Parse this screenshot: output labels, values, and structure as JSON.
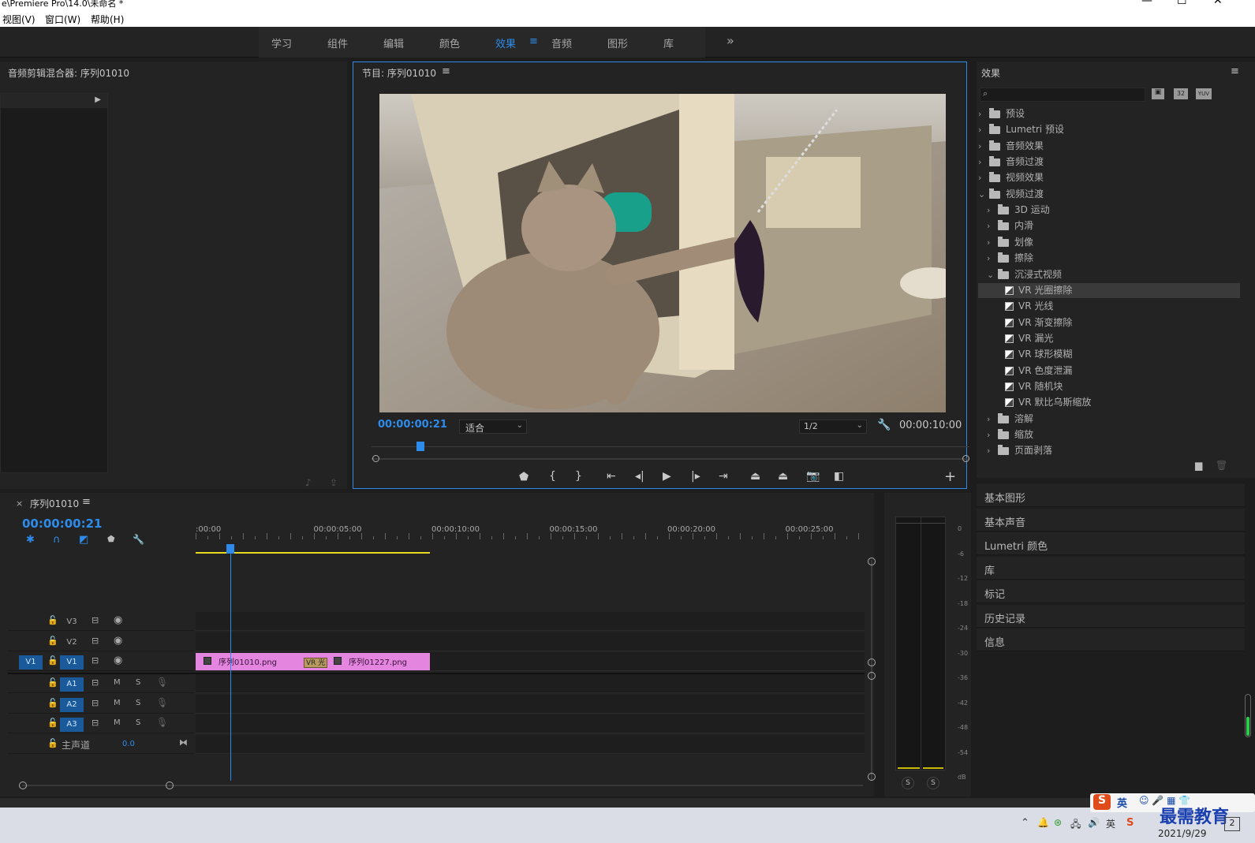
{
  "window": {
    "title": "e\\Premiere Pro\\14.0\\未命名 *",
    "minimize": "—",
    "maximize": "☐",
    "close": "✕"
  },
  "menu": {
    "items": [
      "视图(V)",
      "窗口(W)",
      "帮助(H)"
    ]
  },
  "workspaces": {
    "items": [
      "学习",
      "组件",
      "编辑",
      "颜色",
      "效果",
      "音频",
      "图形",
      "库"
    ],
    "active": "效果",
    "more": "»"
  },
  "audio_mixer": {
    "title": "音频剪辑混合器: 序列01010"
  },
  "program": {
    "title": "节目: 序列01010",
    "timecode": "00:00:00:21",
    "fit": "适合",
    "resolution": "1/2",
    "duration": "00:00:10:00",
    "add": "+"
  },
  "effects": {
    "title": "效果",
    "search_placeholder": "",
    "badges": [
      "32",
      "YUV"
    ],
    "tree": [
      {
        "label": "预设",
        "level": 0,
        "open": false,
        "kind": "star-folder"
      },
      {
        "label": "Lumetri 预设",
        "level": 0,
        "open": false,
        "kind": "star-folder"
      },
      {
        "label": "音频效果",
        "level": 0,
        "open": false,
        "kind": "folder"
      },
      {
        "label": "音频过渡",
        "level": 0,
        "open": false,
        "kind": "folder"
      },
      {
        "label": "视频效果",
        "level": 0,
        "open": false,
        "kind": "folder"
      },
      {
        "label": "视频过渡",
        "level": 0,
        "open": true,
        "kind": "folder"
      },
      {
        "label": "3D 运动",
        "level": 1,
        "open": false,
        "kind": "folder"
      },
      {
        "label": "内滑",
        "level": 1,
        "open": false,
        "kind": "folder"
      },
      {
        "label": "划像",
        "level": 1,
        "open": false,
        "kind": "folder"
      },
      {
        "label": "擦除",
        "level": 1,
        "open": false,
        "kind": "folder"
      },
      {
        "label": "沉浸式视频",
        "level": 1,
        "open": true,
        "kind": "folder"
      },
      {
        "label": "VR 光圈擦除",
        "level": 2,
        "kind": "fx",
        "selected": true
      },
      {
        "label": "VR 光线",
        "level": 2,
        "kind": "fx"
      },
      {
        "label": "VR 渐变擦除",
        "level": 2,
        "kind": "fx"
      },
      {
        "label": "VR 漏光",
        "level": 2,
        "kind": "fx"
      },
      {
        "label": "VR 球形模糊",
        "level": 2,
        "kind": "fx"
      },
      {
        "label": "VR 色度泄漏",
        "level": 2,
        "kind": "fx"
      },
      {
        "label": "VR 随机块",
        "level": 2,
        "kind": "fx"
      },
      {
        "label": "VR 默比乌斯缩放",
        "level": 2,
        "kind": "fx"
      },
      {
        "label": "溶解",
        "level": 1,
        "open": false,
        "kind": "folder"
      },
      {
        "label": "缩放",
        "level": 1,
        "open": false,
        "kind": "folder"
      },
      {
        "label": "页面剥落",
        "level": 1,
        "open": false,
        "kind": "folder"
      }
    ]
  },
  "side_panels": [
    "基本图形",
    "基本声音",
    "Lumetri 颜色",
    "库",
    "标记",
    "历史记录",
    "信息"
  ],
  "timeline": {
    "tab": "序列01010",
    "timecode": "00:00:00:21",
    "ruler": [
      ":00:00",
      "00:00:05:00",
      "00:00:10:00",
      "00:00:15:00",
      "00:00:20:00",
      "00:00:25:00"
    ],
    "video_tracks": [
      "V3",
      "V2",
      "V1"
    ],
    "source_v": "V1",
    "audio_tracks": [
      "A1",
      "A2",
      "A3"
    ],
    "m": "M",
    "s": "S",
    "master": "主声道",
    "master_value": "0.0",
    "clips": [
      {
        "name": "序列01010.png"
      },
      {
        "name": "序列01227.png"
      }
    ],
    "transition": "VR 光",
    "playhead_fraction": 0.0233
  },
  "meters": {
    "scale": [
      "0",
      "-6",
      "-12",
      "-18",
      "-24",
      "-30",
      "-36",
      "-42",
      "-48",
      "-54",
      "dB"
    ],
    "solo": [
      "S",
      "S"
    ]
  },
  "taskbar": {
    "date": "2021/9/29",
    "ime": "英",
    "watermark": "最需教育",
    "badge": "2"
  },
  "colors": {
    "accent": "#2d8ceb",
    "clip": "#e486e0",
    "work_area": "#e8d820"
  }
}
